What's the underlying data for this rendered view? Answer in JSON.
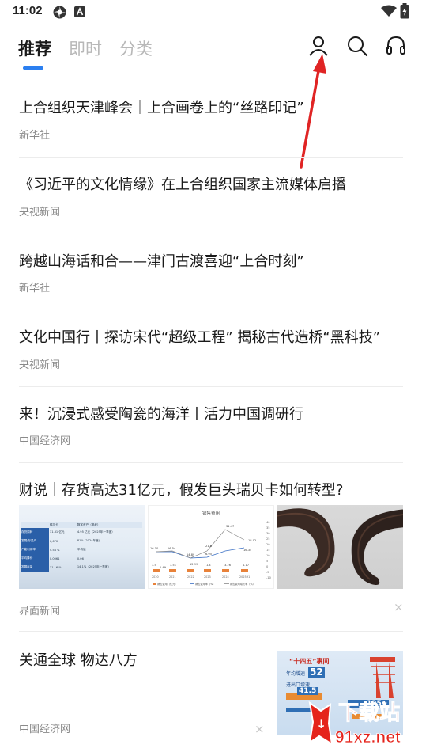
{
  "status_bar": {
    "time": "11:02"
  },
  "tabs": [
    {
      "label": "推荐",
      "active": true
    },
    {
      "label": "即时",
      "active": false
    },
    {
      "label": "分类",
      "active": false
    }
  ],
  "header_icons": [
    "user-icon",
    "search-icon",
    "headphones-icon"
  ],
  "feed": [
    {
      "title": "上合组织天津峰会｜上合画卷上的“丝路印记”",
      "source": "新华社"
    },
    {
      "title": "《习近平的文化情缘》在上合组织国家主流媒体启播",
      "source": "央视新闻"
    },
    {
      "title": "跨越山海话和合——津门古渡喜迎“上合时刻”",
      "source": "新华社"
    },
    {
      "title": "文化中国行丨探访宋代“超级工程” 揭秘古代造桥“黑科技”",
      "source": "央视新闻"
    },
    {
      "title": "来！沉浸式感受陶瓷的海洋丨活力中国调研行",
      "source": "中国经济网"
    },
    {
      "title": "财说｜存货高达31亿元，假发巨头瑞贝卡如何转型?",
      "source": "界面新闻",
      "chart_thumb": {
        "title": "销售费用",
        "categories": [
          "2020",
          "2021",
          "2022",
          "2023",
          "2024",
          "2025H1"
        ],
        "bar_labels": [
          "3.5",
          "1.49",
          "3.51",
          "12.99",
          "1.4",
          "3.26",
          "1.17"
        ],
        "line_labels": [
          "16.10",
          "16.54",
          "14.89",
          "21.6",
          "6.95",
          "31.47",
          "18.02",
          "16.35"
        ],
        "right_axis": [
          "40",
          "35",
          "30",
          "25",
          "20",
          "15",
          "10",
          "5",
          "0",
          "-5",
          "-10"
        ],
        "legend": [
          "销售费用（亿元）",
          "销售费用率（%）",
          "销售费用增长率（%）"
        ]
      },
      "table_thumb": {
        "headers": [
          "",
          "瑞贝卡",
          "数字资产（参考）"
        ],
        "rows": [
          [
            "存货周转",
            "11.31 亿元",
            "4.95 亿元（2025年一季度）"
          ],
          [
            "发展/存量产",
            "6,670",
            "81% (2024年度)"
          ],
          [
            "产能利用率",
            "4.54 %",
            "平均值"
          ],
          [
            "平均降价",
            "0.0061",
            "0.06"
          ],
          [
            "发展存量",
            "11.16 %",
            "14.1%（2025年一季度）"
          ]
        ]
      }
    },
    {
      "title": "关通全球 物达八方",
      "source": "中国经济网"
    }
  ],
  "close_glyph": "×",
  "watermark": {
    "text1": "下载站",
    "text2": "91xz.net"
  },
  "poster_text": {
    "headline": "“十四五”裹间",
    "sub1": "年均增速",
    "big": "52",
    "rate": "41.5",
    "label": "进出口增速",
    "extra": "125+"
  },
  "colors": {
    "accent": "#2b7ff0",
    "annotation_arrow": "#e02424"
  }
}
